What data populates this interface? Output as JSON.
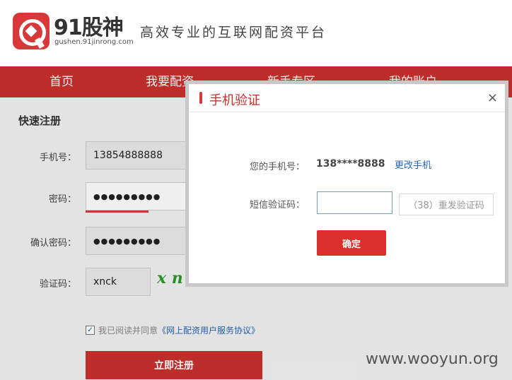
{
  "brand": {
    "name": "91股神",
    "url": "gushen.91jinrong.com",
    "slogan": "高效专业的互联网配资平台"
  },
  "nav": {
    "items": [
      "首页",
      "我要配资",
      "新手专区",
      "我的账户"
    ]
  },
  "form": {
    "title": "快速注册",
    "phone_label": "手机号：",
    "phone_value": "13854888888",
    "password_label": "密码：",
    "password_value": "●●●●●●●●●",
    "confirm_label": "确认密码：",
    "confirm_value": "●●●●●●●●●",
    "captcha_label": "验证码：",
    "captcha_value": "xnck",
    "captcha_image_text": "x n",
    "agree_text": "我已阅读并同意",
    "agree_link": "《网上配资用户服务协议》",
    "register_button": "立即注册"
  },
  "modal": {
    "title": "手机验证",
    "close": "×",
    "phone_label": "您的手机号：",
    "phone_value": "138****8888",
    "change_phone": "更改手机",
    "sms_label": "短信验证码：",
    "resend_button": "（38）重发验证码",
    "confirm_button": "确定"
  },
  "watermark": "www.wooyun.org",
  "colors": {
    "brand_red": "#c9302c",
    "link_blue": "#2466b4",
    "captcha_green": "#2a9a2a"
  }
}
